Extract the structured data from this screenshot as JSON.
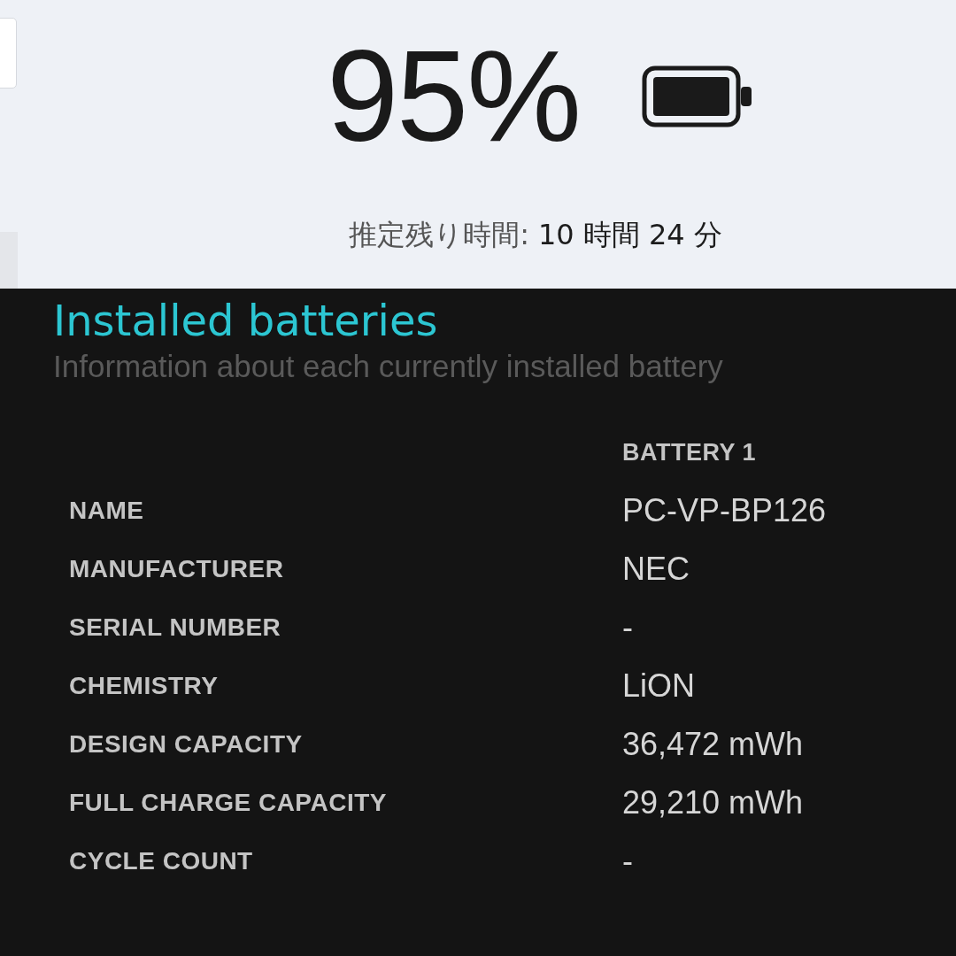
{
  "battery_summary": {
    "percentage": "95%",
    "remaining_label": "推定残り時間:",
    "remaining_value": "10 時間 24 分"
  },
  "installed_batteries": {
    "title": "Installed batteries",
    "subtitle": "Information about each currently installed battery",
    "columns": [
      "BATTERY 1"
    ],
    "rows": [
      {
        "label": "NAME",
        "value": "PC-VP-BP126"
      },
      {
        "label": "MANUFACTURER",
        "value": "NEC"
      },
      {
        "label": "SERIAL NUMBER",
        "value": "-"
      },
      {
        "label": "CHEMISTRY",
        "value": "LiON"
      },
      {
        "label": "DESIGN CAPACITY",
        "value": "36,472 mWh"
      },
      {
        "label": "FULL CHARGE CAPACITY",
        "value": "29,210 mWh"
      },
      {
        "label": "CYCLE COUNT",
        "value": "-"
      }
    ]
  }
}
